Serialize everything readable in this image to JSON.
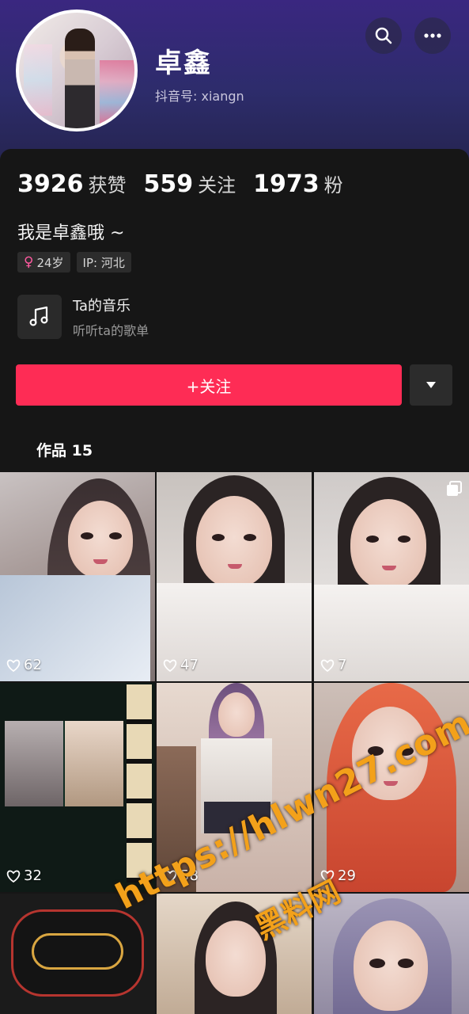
{
  "header": {
    "name": "卓鑫",
    "douyin_id": "抖音号: xiangn",
    "search_icon": "search-icon",
    "more_icon": "more-dots-icon"
  },
  "stats": [
    {
      "value": "3926",
      "label": "获赞"
    },
    {
      "value": "559",
      "label": "关注"
    },
    {
      "value": "1973",
      "label": "粉"
    }
  ],
  "bio": "我是卓鑫哦 ~",
  "tags": {
    "gender_symbol": "♀",
    "age": "24岁",
    "ip": "IP: 河北"
  },
  "music": {
    "title": "Ta的音乐",
    "subtitle": "听听ta的歌单"
  },
  "actions": {
    "follow_label": "+关注"
  },
  "works_tab": {
    "label": "作品 15"
  },
  "works": [
    {
      "likes": "62"
    },
    {
      "likes": "47"
    },
    {
      "likes": "7"
    },
    {
      "likes": "32"
    },
    {
      "likes": "58"
    },
    {
      "likes": "29"
    },
    {
      "likes": ""
    },
    {
      "likes": ""
    },
    {
      "likes": ""
    }
  ],
  "watermark": {
    "url": "https://hlwn27.com",
    "cn": "黑料网"
  },
  "colors": {
    "accent": "#fe2c55",
    "header_top": "#3a2780",
    "background": "#161616",
    "watermark": "#f3a11a"
  }
}
